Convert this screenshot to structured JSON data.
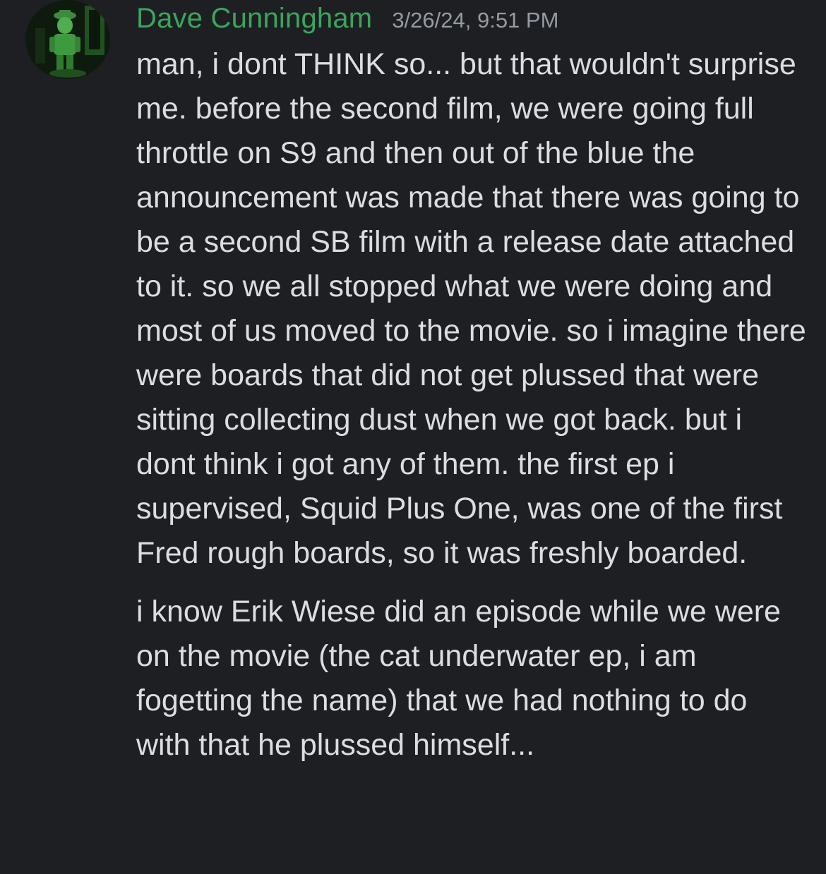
{
  "message": {
    "author": "Dave Cunningham",
    "timestamp": "3/26/24, 9:51 PM",
    "author_color": "#3ba55c",
    "avatar": "avatar-image",
    "paragraphs": [
      "man, i dont THINK so... but that wouldn't surprise me. before the second film, we were going full throttle on S9 and then out of the blue the announcement was made that there was going to be a second SB film with a release date attached to it. so we all stopped what we were doing and most of us moved to the movie. so i imagine there were boards that did not get plussed that were sitting collecting dust when we got back. but i dont think i got any of them. the first ep i supervised, Squid Plus One, was one of the first Fred rough boards, so it was freshly boarded.",
      "i know Erik Wiese did an episode while we were on the movie (the cat underwater ep, i am fogetting the name) that we had nothing to do with that he plussed himself..."
    ]
  },
  "theme": {
    "background": "#1e1f22",
    "text": "#dbdee1",
    "muted": "#949ba4"
  }
}
